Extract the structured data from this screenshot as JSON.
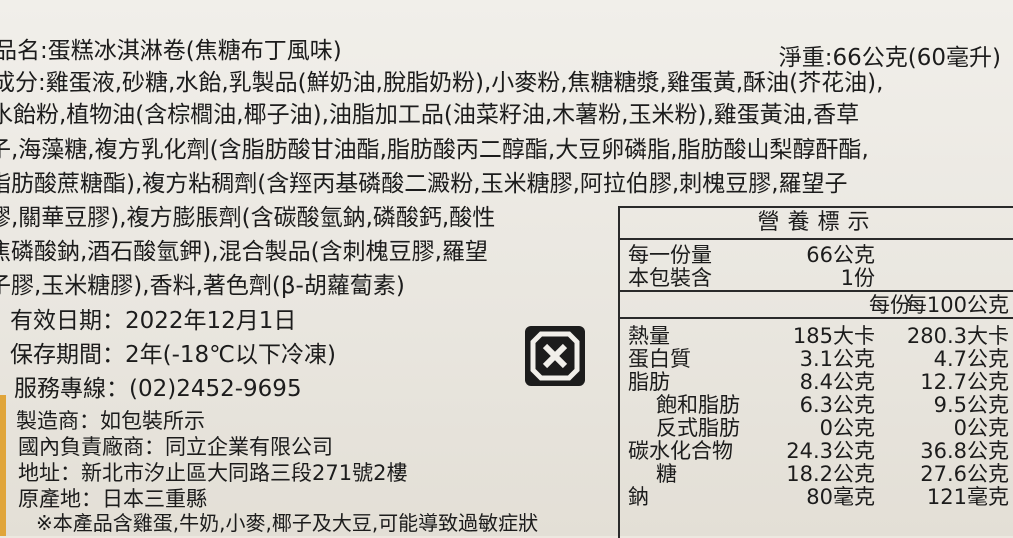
{
  "product": {
    "name_line": "品名:蛋糕冰淇淋卷(焦糖布丁風味)",
    "net_weight": "淨重:66公克(60毫升)"
  },
  "ingredients": {
    "lines": [
      "成分:雞蛋液,砂糖,水飴,乳製品(鮮奶油,脫脂奶粉),小麥粉,焦糖糖漿,雞蛋黃,酥油(芥花油),",
      "水飴粉,植物油(含棕櫚油,椰子油),油脂加工品(油菜籽油,木薯粉,玉米粉),雞蛋黃油,香草",
      "子,海藻糖,複方乳化劑(含脂肪酸甘油酯,脂肪酸丙二醇酯,大豆卵磷脂,脂肪酸山梨醇酐酯,",
      "脂肪酸蔗糖酯),複方粘稠劑(含羥丙基磷酸二澱粉,玉米糖膠,阿拉伯膠,刺槐豆膠,羅望子",
      "膠,關華豆膠),複方膨脹劑(含碳酸氫鈉,磷酸鈣,酸性",
      "焦磷酸鈉,酒石酸氫鉀),混合製品(含刺槐豆膠,羅望",
      "子膠,玉米糖膠),香料,著色劑(β-胡蘿蔔素)"
    ]
  },
  "info": {
    "expiry": "有效日期：2022年12月1日",
    "storage": "保存期間：2年(-18℃以下冷凍)",
    "hotline": "服務專線：(02)2452-9695",
    "manufacturer": "製造商：如包裝所示",
    "responsible": "國內負責廠商：同立企業有限公司",
    "address": "地址：新北市汐止區大同路三段271號2樓",
    "origin": "原產地：日本三重縣",
    "allergen": "※本產品含雞蛋,牛奶,小麥,椰子及大豆,可能導致過敏症狀"
  },
  "nutrition": {
    "title": "營養標示",
    "serving_label": "每一份量",
    "serving_value": "66公克",
    "servings_label": "本包裝含",
    "servings_value": "1份",
    "col_per_serving": "每份",
    "col_per_100": "每100公克",
    "rows": [
      {
        "name": "熱量",
        "per": "185大卡",
        "per100": "280.3大卡"
      },
      {
        "name": "蛋白質",
        "per": "3.1公克",
        "per100": "4.7公克"
      },
      {
        "name": "脂肪",
        "per": "8.4公克",
        "per100": "12.7公克"
      },
      {
        "name": "飽和脂肪",
        "per": "6.3公克",
        "per100": "9.5公克"
      },
      {
        "name": "反式脂肪",
        "per": "0公克",
        "per100": "0公克"
      },
      {
        "name": "碳水化合物",
        "per": "24.3公克",
        "per100": "36.8公克"
      },
      {
        "name": "糖",
        "per": "18.2公克",
        "per100": "27.6公克"
      },
      {
        "name": "鈉",
        "per": "80毫克",
        "per100": "121毫克"
      }
    ]
  },
  "icons": {
    "recycle": "recycle-icon"
  }
}
